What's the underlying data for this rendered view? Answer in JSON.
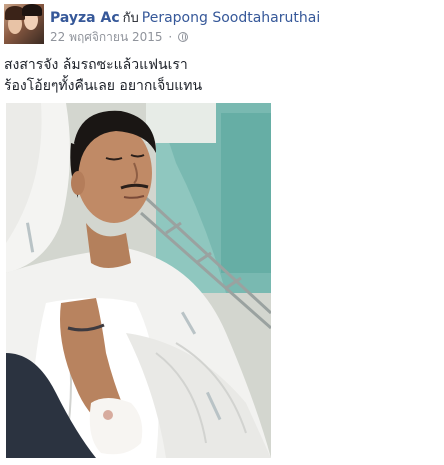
{
  "post": {
    "author": "Payza Ac",
    "with_text": "กับ",
    "tagged_user": "Perapong Soodtaharuthai",
    "date": "22 พฤศจิกายน 2015",
    "separator": "·",
    "privacy_icon": "globe-icon",
    "text_line_1": "สงสารจัง ล้มรถซะแล้วแฟนเรา",
    "text_line_2": "ร้องโอ้ยๆทั้งคืนเลย อยากเจ็บแทน"
  },
  "colors": {
    "link": "#365899",
    "meta": "#90949c",
    "text": "#1d2129"
  }
}
